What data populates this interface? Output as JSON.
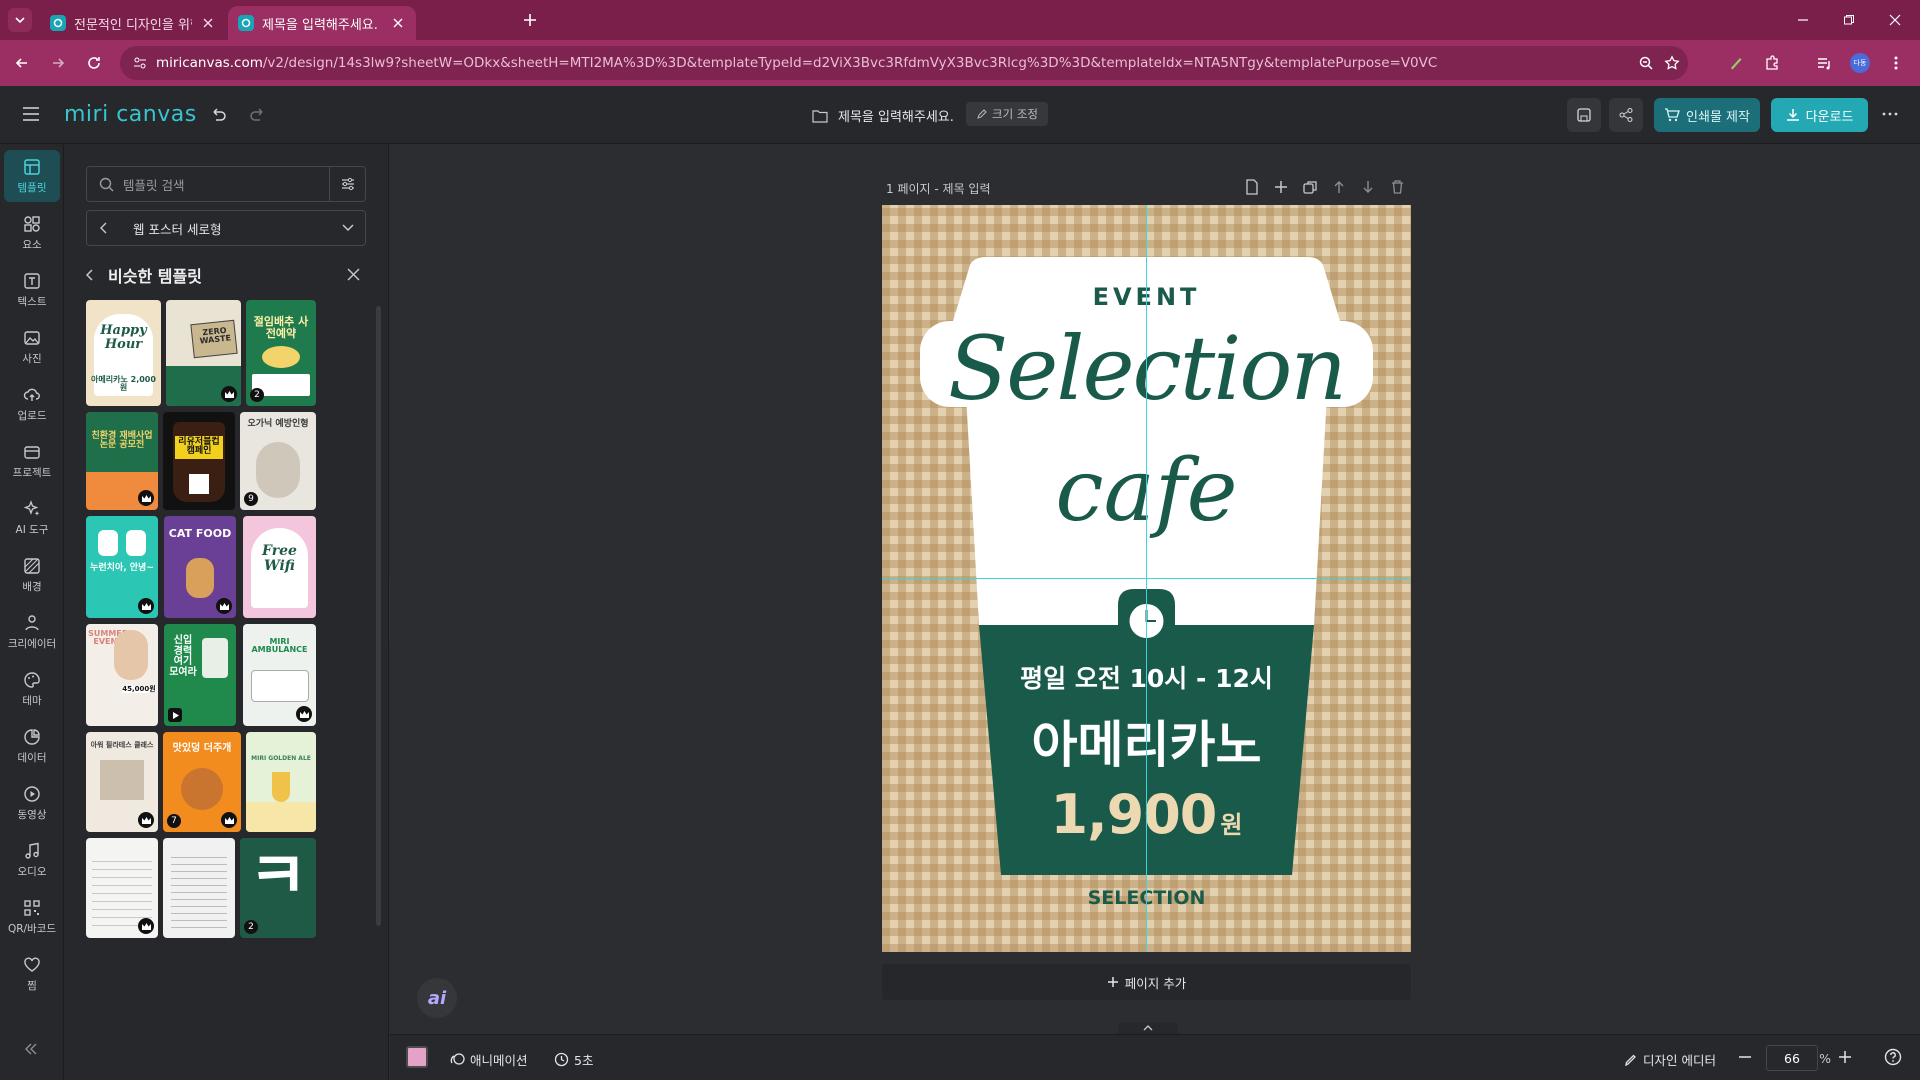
{
  "browser": {
    "tabs": [
      {
        "title": "전문적인 디자인을 위한 무료 A",
        "active": false
      },
      {
        "title": "제목을 입력해주세요. - 미리캔",
        "active": true
      }
    ],
    "url_host": "miricanvas.com",
    "url_path": "/v2/design/14s3lw9?sheetW=ODkx&sheetH=MTI2MA%3D%3D&templateTypeId=d2ViX3Bvc3RfdmVyX3Bvc3Rlcg%3D%3D&templateIdx=NTA5NTgy&templatePurpose=V0VC",
    "profile_initials": "다동"
  },
  "app": {
    "logo": "miri canvas",
    "doc_title": "제목을 입력해주세요.",
    "resize_label": "크기 조정",
    "print_label": "인쇄물 제작",
    "download_label": "다운로드"
  },
  "rail": [
    {
      "label": "템플릿",
      "icon": "template-icon"
    },
    {
      "label": "요소",
      "icon": "elements-icon"
    },
    {
      "label": "텍스트",
      "icon": "text-icon"
    },
    {
      "label": "사진",
      "icon": "photo-icon"
    },
    {
      "label": "업로드",
      "icon": "upload-icon"
    },
    {
      "label": "프로젝트",
      "icon": "project-icon"
    },
    {
      "label": "AI 도구",
      "icon": "ai-tools-icon"
    },
    {
      "label": "배경",
      "icon": "background-icon"
    },
    {
      "label": "크리에이터",
      "icon": "creator-icon"
    },
    {
      "label": "테마",
      "icon": "theme-icon"
    },
    {
      "label": "데이터",
      "icon": "data-icon"
    },
    {
      "label": "동영상",
      "icon": "video-icon"
    },
    {
      "label": "오디오",
      "icon": "audio-icon"
    },
    {
      "label": "QR/바코드",
      "icon": "qr-icon"
    },
    {
      "label": "찜",
      "icon": "heart-icon"
    }
  ],
  "panel": {
    "search_placeholder": "템플릿 검색",
    "filter_value": "웹 포스터 세로형",
    "section_title": "비슷한 템플릿",
    "thumbs": [
      {
        "text": "Happy Hour",
        "sub": "아메리카노 2,000원",
        "bg": "#f1e3c8",
        "fg": "#1e5a48"
      },
      {
        "text": "ZERO WASTE",
        "sub": "",
        "bg": "#e9e3d4",
        "fg": "#2b2b2b"
      },
      {
        "text": "절임배추 사전예약",
        "sub": "",
        "bg": "#1f7a4d",
        "fg": "#fff1a8",
        "count": "2"
      },
      {
        "text": "친환경 재배사업 논문 공모전",
        "sub": "",
        "bg": "#f08a3c",
        "fg": "#1f6f4a"
      },
      {
        "text": "리유저블컵 캠페인",
        "sub": "",
        "bg": "#111111",
        "fg": "#f2d11e"
      },
      {
        "text": "오가닉 예방인형",
        "sub": "",
        "bg": "#e9e6df",
        "fg": "#3b3b3b",
        "count": "9"
      },
      {
        "text": "누런치아, 안녕~",
        "sub": "",
        "bg": "#2cc7b4",
        "fg": "#ffffff"
      },
      {
        "text": "CAT FOOD",
        "sub": "",
        "bg": "#6a3f96",
        "fg": "#ffffff"
      },
      {
        "text": "Free Wifi",
        "sub": "",
        "bg": "#f3c6de",
        "fg": "#1e5a48"
      },
      {
        "text": "SUMMER EVENT",
        "sub": "45,000원",
        "bg": "#f3efe8",
        "fg": "#c63b2f"
      },
      {
        "text": "신입 경력 여기 모여라",
        "sub": "",
        "bg": "#1f8a4c",
        "fg": "#ffffff"
      },
      {
        "text": "MIRI AMBULANCE",
        "sub": "",
        "bg": "#eef2ef",
        "fg": "#1f8a4c"
      },
      {
        "text": "아워 필라테스 클래스",
        "sub": "",
        "bg": "#efe9e0",
        "fg": "#3b3b3b"
      },
      {
        "text": "맛있덩 더주개",
        "sub": "",
        "bg": "#f28c1e",
        "fg": "#ffffff",
        "count": "7"
      },
      {
        "text": "MIRI GOLDEN ALE",
        "sub": "",
        "bg": "#e6f2d8",
        "fg": "#3a7f5c"
      },
      {
        "text": "",
        "sub": "",
        "bg": "#f4f4f2",
        "fg": "#333333"
      },
      {
        "text": "",
        "sub": "",
        "bg": "#f1f1f1",
        "fg": "#333333"
      },
      {
        "text": "ㅋ",
        "sub": "",
        "bg": "#1f5a46",
        "fg": "#ffffff",
        "count": "2"
      }
    ]
  },
  "workspace": {
    "page_label": "1 페이지 - 제목 입력",
    "add_page_label": "페이지 추가",
    "poster": {
      "event": "EVENT",
      "title_line1": "Selection",
      "title_line2": "cafe",
      "time": "평일 오전 10시 - 12시",
      "item": "아메리카노",
      "price": "1,900",
      "currency": "원",
      "footer": "SELECTION"
    }
  },
  "bottombar": {
    "animation_label": "애니메이션",
    "duration_label": "5초",
    "design_editor_label": "디자인 에디터",
    "zoom_value": "66",
    "zoom_unit": "%"
  },
  "colors": {
    "accent": "#23a8b4",
    "poster_green": "#1a5a4a",
    "poster_bg": "#e3d0ae",
    "price_color": "#ecd9b2",
    "browser_frame": "#9b2e62"
  }
}
